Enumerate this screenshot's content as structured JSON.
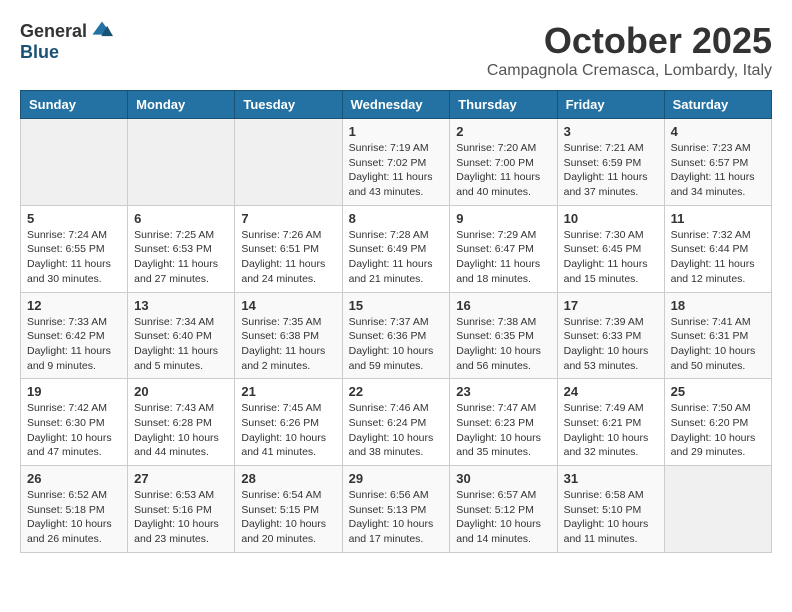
{
  "logo": {
    "general": "General",
    "blue": "Blue"
  },
  "title": "October 2025",
  "location": "Campagnola Cremasca, Lombardy, Italy",
  "headers": [
    "Sunday",
    "Monday",
    "Tuesday",
    "Wednesday",
    "Thursday",
    "Friday",
    "Saturday"
  ],
  "rows": [
    [
      {
        "day": "",
        "info": ""
      },
      {
        "day": "",
        "info": ""
      },
      {
        "day": "",
        "info": ""
      },
      {
        "day": "1",
        "info": "Sunrise: 7:19 AM\nSunset: 7:02 PM\nDaylight: 11 hours\nand 43 minutes."
      },
      {
        "day": "2",
        "info": "Sunrise: 7:20 AM\nSunset: 7:00 PM\nDaylight: 11 hours\nand 40 minutes."
      },
      {
        "day": "3",
        "info": "Sunrise: 7:21 AM\nSunset: 6:59 PM\nDaylight: 11 hours\nand 37 minutes."
      },
      {
        "day": "4",
        "info": "Sunrise: 7:23 AM\nSunset: 6:57 PM\nDaylight: 11 hours\nand 34 minutes."
      }
    ],
    [
      {
        "day": "5",
        "info": "Sunrise: 7:24 AM\nSunset: 6:55 PM\nDaylight: 11 hours\nand 30 minutes."
      },
      {
        "day": "6",
        "info": "Sunrise: 7:25 AM\nSunset: 6:53 PM\nDaylight: 11 hours\nand 27 minutes."
      },
      {
        "day": "7",
        "info": "Sunrise: 7:26 AM\nSunset: 6:51 PM\nDaylight: 11 hours\nand 24 minutes."
      },
      {
        "day": "8",
        "info": "Sunrise: 7:28 AM\nSunset: 6:49 PM\nDaylight: 11 hours\nand 21 minutes."
      },
      {
        "day": "9",
        "info": "Sunrise: 7:29 AM\nSunset: 6:47 PM\nDaylight: 11 hours\nand 18 minutes."
      },
      {
        "day": "10",
        "info": "Sunrise: 7:30 AM\nSunset: 6:45 PM\nDaylight: 11 hours\nand 15 minutes."
      },
      {
        "day": "11",
        "info": "Sunrise: 7:32 AM\nSunset: 6:44 PM\nDaylight: 11 hours\nand 12 minutes."
      }
    ],
    [
      {
        "day": "12",
        "info": "Sunrise: 7:33 AM\nSunset: 6:42 PM\nDaylight: 11 hours\nand 9 minutes."
      },
      {
        "day": "13",
        "info": "Sunrise: 7:34 AM\nSunset: 6:40 PM\nDaylight: 11 hours\nand 5 minutes."
      },
      {
        "day": "14",
        "info": "Sunrise: 7:35 AM\nSunset: 6:38 PM\nDaylight: 11 hours\nand 2 minutes."
      },
      {
        "day": "15",
        "info": "Sunrise: 7:37 AM\nSunset: 6:36 PM\nDaylight: 10 hours\nand 59 minutes."
      },
      {
        "day": "16",
        "info": "Sunrise: 7:38 AM\nSunset: 6:35 PM\nDaylight: 10 hours\nand 56 minutes."
      },
      {
        "day": "17",
        "info": "Sunrise: 7:39 AM\nSunset: 6:33 PM\nDaylight: 10 hours\nand 53 minutes."
      },
      {
        "day": "18",
        "info": "Sunrise: 7:41 AM\nSunset: 6:31 PM\nDaylight: 10 hours\nand 50 minutes."
      }
    ],
    [
      {
        "day": "19",
        "info": "Sunrise: 7:42 AM\nSunset: 6:30 PM\nDaylight: 10 hours\nand 47 minutes."
      },
      {
        "day": "20",
        "info": "Sunrise: 7:43 AM\nSunset: 6:28 PM\nDaylight: 10 hours\nand 44 minutes."
      },
      {
        "day": "21",
        "info": "Sunrise: 7:45 AM\nSunset: 6:26 PM\nDaylight: 10 hours\nand 41 minutes."
      },
      {
        "day": "22",
        "info": "Sunrise: 7:46 AM\nSunset: 6:24 PM\nDaylight: 10 hours\nand 38 minutes."
      },
      {
        "day": "23",
        "info": "Sunrise: 7:47 AM\nSunset: 6:23 PM\nDaylight: 10 hours\nand 35 minutes."
      },
      {
        "day": "24",
        "info": "Sunrise: 7:49 AM\nSunset: 6:21 PM\nDaylight: 10 hours\nand 32 minutes."
      },
      {
        "day": "25",
        "info": "Sunrise: 7:50 AM\nSunset: 6:20 PM\nDaylight: 10 hours\nand 29 minutes."
      }
    ],
    [
      {
        "day": "26",
        "info": "Sunrise: 6:52 AM\nSunset: 5:18 PM\nDaylight: 10 hours\nand 26 minutes."
      },
      {
        "day": "27",
        "info": "Sunrise: 6:53 AM\nSunset: 5:16 PM\nDaylight: 10 hours\nand 23 minutes."
      },
      {
        "day": "28",
        "info": "Sunrise: 6:54 AM\nSunset: 5:15 PM\nDaylight: 10 hours\nand 20 minutes."
      },
      {
        "day": "29",
        "info": "Sunrise: 6:56 AM\nSunset: 5:13 PM\nDaylight: 10 hours\nand 17 minutes."
      },
      {
        "day": "30",
        "info": "Sunrise: 6:57 AM\nSunset: 5:12 PM\nDaylight: 10 hours\nand 14 minutes."
      },
      {
        "day": "31",
        "info": "Sunrise: 6:58 AM\nSunset: 5:10 PM\nDaylight: 10 hours\nand 11 minutes."
      },
      {
        "day": "",
        "info": ""
      }
    ]
  ]
}
